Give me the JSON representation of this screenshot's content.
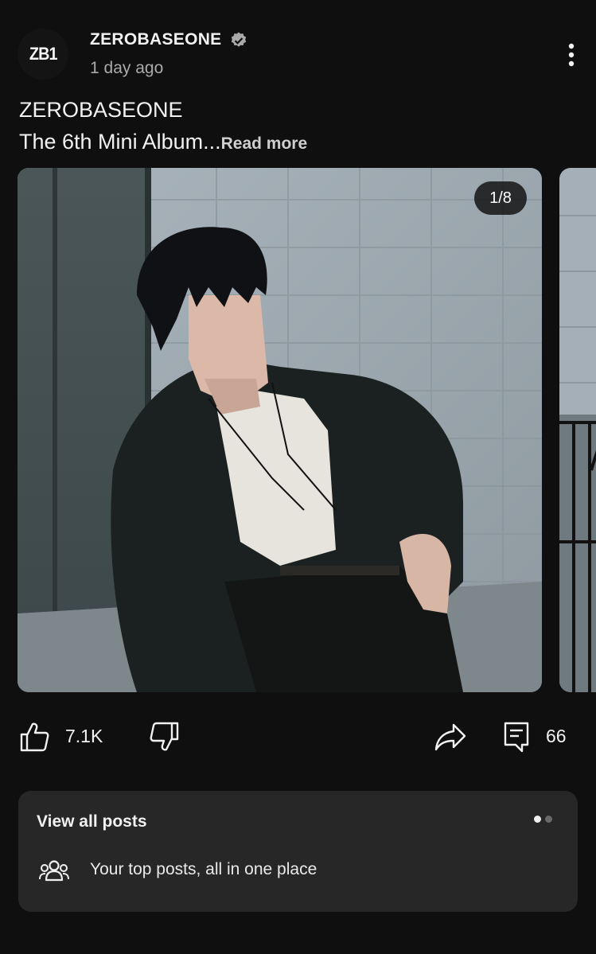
{
  "post": {
    "avatar_text": "ZB1",
    "channel_name": "ZEROBASEONE",
    "time_ago": "1 day ago",
    "text_line1": "ZEROBASEONE",
    "text_line2": "The 6th Mini Album",
    "ellipsis": "...",
    "read_more": "Read more",
    "image_counter": "1/8"
  },
  "actions": {
    "like_count": "7.1K",
    "comment_count": "66"
  },
  "card": {
    "title": "View all posts",
    "subtitle": "Your top posts, all in one place",
    "page_indicator": {
      "active": 1,
      "total": 2
    }
  },
  "icons": {
    "verified": "verified-badge-icon",
    "menu": "more-vertical-icon",
    "like": "thumbs-up-icon",
    "dislike": "thumbs-down-icon",
    "share": "share-icon",
    "comment": "comment-icon",
    "people": "people-icon"
  },
  "colors": {
    "background": "#0f0f0f",
    "card_background": "#272727",
    "text_primary": "#f1f1f1",
    "text_secondary": "#aaaaaa"
  }
}
